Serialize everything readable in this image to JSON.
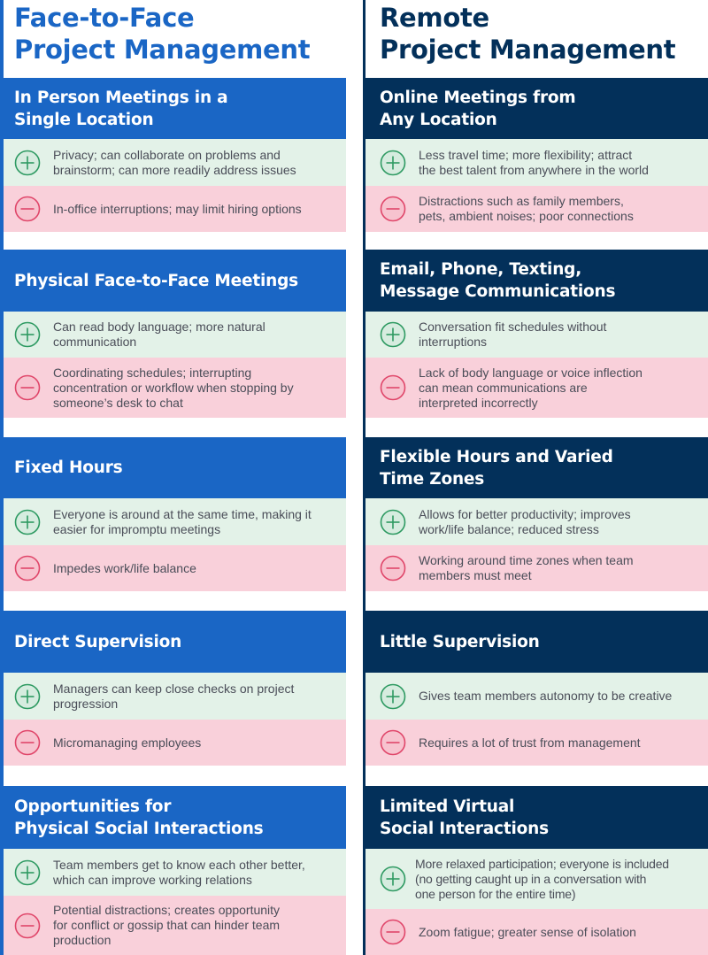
{
  "colors": {
    "face_to_face_accent": "#1a66c5",
    "remote_accent": "#03305a",
    "pro_background": "#e3f2e8",
    "con_background": "#f9d0da",
    "pro_icon": "#2e9a62",
    "con_icon": "#e0466a",
    "body_text": "#4a4d58"
  },
  "icons": {
    "pro": "plus-circle-icon",
    "con": "minus-circle-icon"
  },
  "left": {
    "title_lines": [
      "Face-to-Face",
      "Project Management"
    ],
    "sections": [
      {
        "header_lines": [
          "In Person Meetings in a",
          "Single Location"
        ],
        "pro_lines": [
          "Privacy; can collaborate on problems and",
          "brainstorm; can more readily address issues"
        ],
        "con_lines": [
          "In-office interruptions; may limit hiring options"
        ]
      },
      {
        "header_lines": [
          "Physical Face-to-Face Meetings"
        ],
        "pro_lines": [
          "Can read body language; more natural",
          "communication"
        ],
        "con_lines": [
          "Coordinating schedules; interrupting",
          "concentration or workflow when stopping by",
          "someone’s desk to chat"
        ]
      },
      {
        "header_lines": [
          "Fixed Hours"
        ],
        "pro_lines": [
          "Everyone is around at the same time, making it",
          "easier for impromptu meetings"
        ],
        "con_lines": [
          "Impedes work/life balance"
        ]
      },
      {
        "header_lines": [
          "Direct Supervision"
        ],
        "pro_lines": [
          "Managers can keep close checks on project",
          "progression"
        ],
        "con_lines": [
          "Micromanaging employees"
        ]
      },
      {
        "header_lines": [
          "Opportunities for",
          "Physical Social Interactions"
        ],
        "pro_lines": [
          "Team members get to know each other better,",
          "which can improve working relations"
        ],
        "con_lines": [
          "Potential distractions; creates opportunity",
          "for conflict or gossip that can hinder team",
          "production"
        ]
      }
    ]
  },
  "right": {
    "title_lines": [
      "Remote",
      "Project Management"
    ],
    "sections": [
      {
        "header_lines": [
          "Online Meetings from",
          "Any Location"
        ],
        "pro_lines": [
          "Less travel time; more flexibility; attract",
          "the best talent from anywhere in the world"
        ],
        "con_lines": [
          "Distractions such as family members,",
          "pets, ambient noises; poor connections"
        ]
      },
      {
        "header_lines": [
          "Email, Phone, Texting,",
          "Message Communications"
        ],
        "pro_lines": [
          "Conversation fit schedules without",
          "interruptions"
        ],
        "con_lines": [
          "Lack of body language or voice inflection",
          "can mean communications are",
          "interpreted incorrectly"
        ]
      },
      {
        "header_lines": [
          "Flexible Hours and Varied",
          "Time Zones"
        ],
        "pro_lines": [
          "Allows for better productivity; improves",
          "work/life balance; reduced stress"
        ],
        "con_lines": [
          "Working around time zones when team",
          "members must meet"
        ]
      },
      {
        "header_lines": [
          "Little Supervision"
        ],
        "pro_lines": [
          "Gives team members autonomy to be creative"
        ],
        "con_lines": [
          "Requires a lot of trust from management"
        ]
      },
      {
        "header_lines": [
          "Limited Virtual",
          "Social Interactions"
        ],
        "pro_lines": [
          "More relaxed participation; everyone is included",
          "(no getting caught up in a conversation with",
          "one person for the entire time)"
        ],
        "con_lines": [
          "Zoom fatigue; greater sense of isolation"
        ]
      }
    ]
  }
}
